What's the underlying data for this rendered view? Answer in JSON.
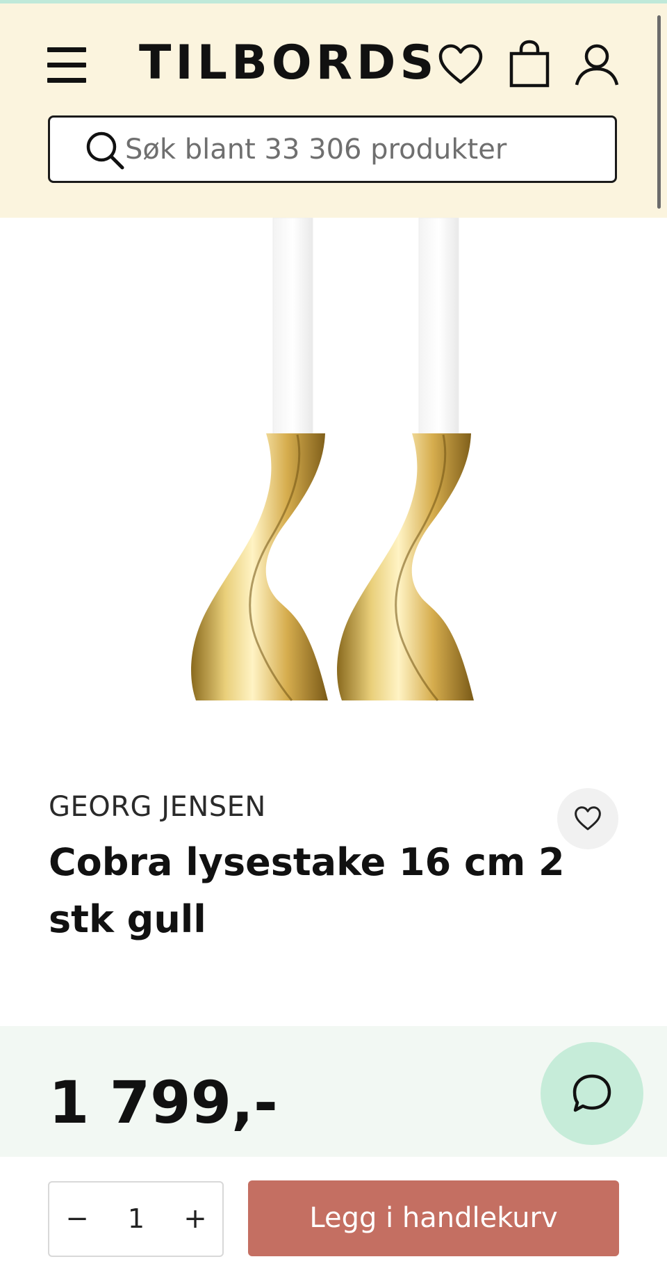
{
  "header": {
    "logo_text": "TILBORDS",
    "icons": [
      "menu-icon",
      "heart-icon",
      "shopping-bag-icon",
      "user-icon"
    ],
    "search": {
      "placeholder": "Søk blant 33 306 produkter",
      "icon": "search-icon"
    }
  },
  "product": {
    "brand": "GEORG JENSEN",
    "title": "Cobra lysestake 16 cm 2 stk gull",
    "image_description": "candle-holders-gold-image",
    "price": "1 799,-"
  },
  "purchase": {
    "quantity": "1",
    "minus_label": "−",
    "plus_label": "+",
    "add_to_cart_label": "Legg i handlekurv"
  },
  "colors": {
    "header_bg": "#fbf4de",
    "top_strip": "#bfe9d9",
    "price_band_bg": "#f2f8f3",
    "chat_button_bg": "#c6ecd9",
    "add_to_cart_bg": "#c46f62",
    "text": "#111111"
  }
}
